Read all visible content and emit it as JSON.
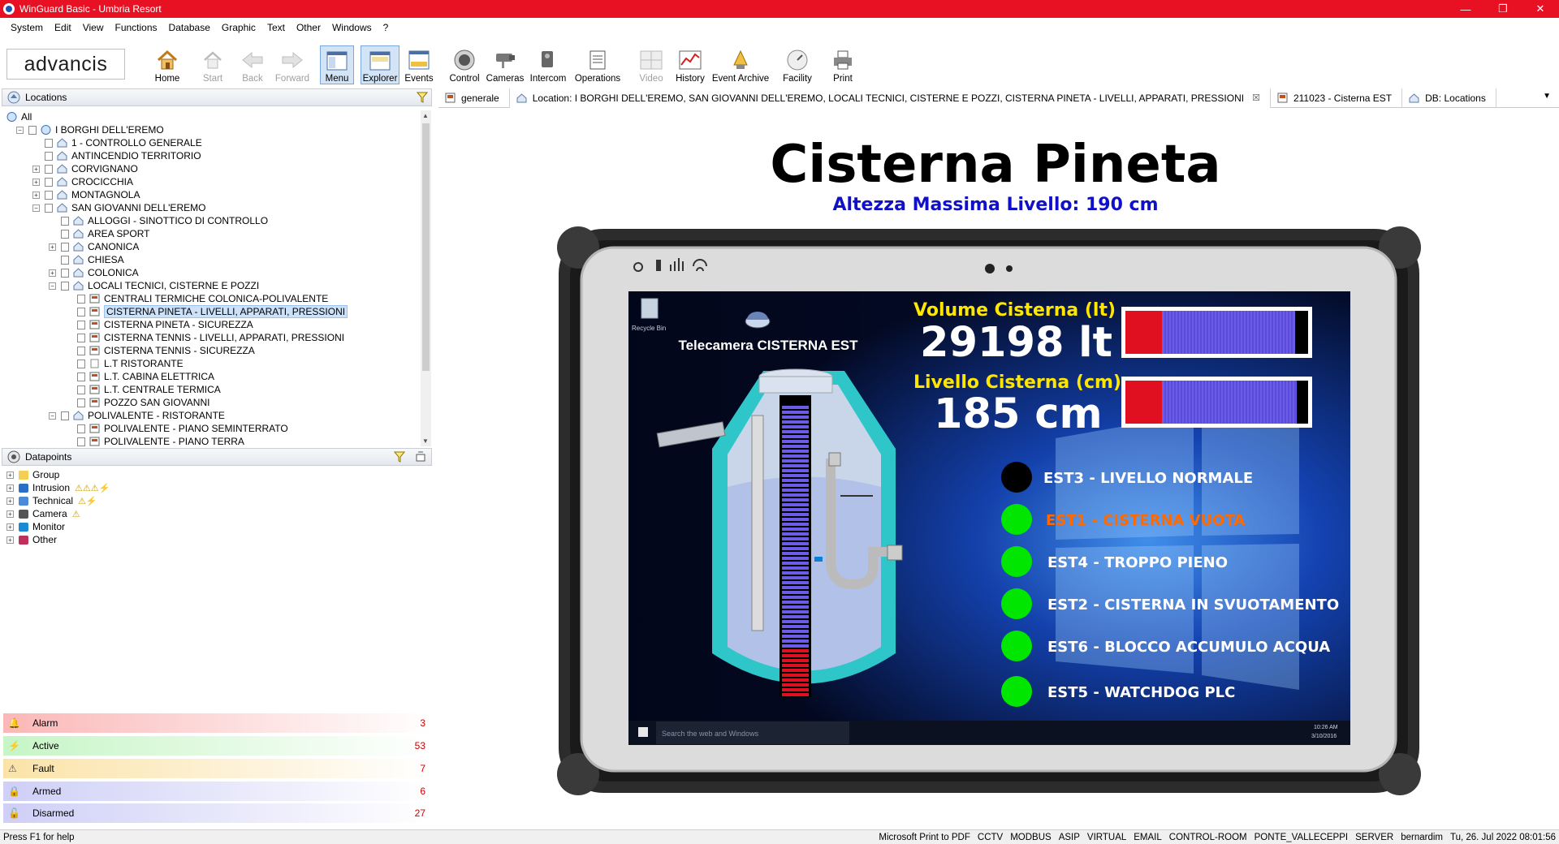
{
  "window": {
    "title": "WinGuard Basic - Umbria Resort"
  },
  "menu": [
    "System",
    "Edit",
    "View",
    "Functions",
    "Database",
    "Graphic",
    "Text",
    "Other",
    "Windows",
    "?"
  ],
  "logo": "advancis",
  "toolbar": {
    "home": "Home",
    "start": "Start",
    "back": "Back",
    "forward": "Forward",
    "menu": "Menu",
    "explorer": "Explorer",
    "events": "Events",
    "control": "Control",
    "cameras": "Cameras",
    "intercom": "Intercom",
    "operations": "Operations",
    "video": "Video",
    "history": "History",
    "event_archive": "Event Archive",
    "facility": "Facility",
    "print": "Print"
  },
  "locations": {
    "title": "Locations",
    "items": [
      "All",
      "I BORGHI DELL'EREMO",
      "1 - CONTROLLO GENERALE",
      "ANTINCENDIO TERRITORIO",
      "CORVIGNANO",
      "CROCICCHIA",
      "MONTAGNOLA",
      "SAN GIOVANNI DELL'EREMO",
      "ALLOGGI - SINOTTICO DI CONTROLLO",
      "AREA SPORT",
      "CANONICA",
      "CHIESA",
      "COLONICA",
      "LOCALI TECNICI, CISTERNE E POZZI",
      "CENTRALI TERMICHE COLONICA-POLIVALENTE",
      "CISTERNA PINETA - LIVELLI, APPARATI, PRESSIONI",
      "CISTERNA PINETA - SICUREZZA",
      "CISTERNA TENNIS - LIVELLI, APPARATI, PRESSIONI",
      "CISTERNA TENNIS - SICUREZZA",
      "L.T RISTORANTE",
      "L.T. CABINA ELETTRICA",
      "L.T. CENTRALE TERMICA",
      "POZZO SAN GIOVANNI",
      "POLIVALENTE - RISTORANTE",
      "POLIVALENTE - PIANO SEMINTERRATO",
      "POLIVALENTE - PIANO TERRA"
    ]
  },
  "datapoints": {
    "title": "Datapoints",
    "items": [
      "Group",
      "Intrusion",
      "Technical",
      "Camera",
      "Monitor",
      "Other"
    ]
  },
  "status": [
    {
      "label": "Alarm",
      "count": "3",
      "color": "#fbb7b7"
    },
    {
      "label": "Active",
      "count": "53",
      "color": "#c6f5c6"
    },
    {
      "label": "Fault",
      "count": "7",
      "color": "#fbe3a8"
    },
    {
      "label": "Armed",
      "count": "6",
      "color": "#cfcff7"
    },
    {
      "label": "Disarmed",
      "count": "27",
      "color": "#cfcff7"
    }
  ],
  "tabs": [
    {
      "label": "generale"
    },
    {
      "label": "Location: I BORGHI DELL'EREMO, SAN GIOVANNI DELL'EREMO, LOCALI TECNICI, CISTERNE E POZZI, CISTERNA PINETA - LIVELLI, APPARATI, PRESSIONI"
    },
    {
      "label": "211023 - Cisterna EST"
    },
    {
      "label": "DB: Locations"
    }
  ],
  "main": {
    "title": "Cisterna Pineta",
    "subtitle": "Altezza Massima Livello: 190 cm",
    "camera_label": "Telecamera CISTERNA EST",
    "recycle_bin": "Recycle Bin",
    "taskbar_search": "Search the web and Windows",
    "taskbar_time": "10:26 AM",
    "taskbar_date": "3/10/2016",
    "volume_label": "Volume Cisterna (lt)",
    "volume_value": "29198 lt",
    "level_label": "Livello Cisterna (cm)",
    "level_value": "185 cm",
    "volume_fill": 0.91,
    "level_fill": 0.92,
    "tank_fill": 0.97,
    "indicators": [
      {
        "label": "EST3 - LIVELLO NORMALE",
        "color": "#000000",
        "text_color": "#ffffff"
      },
      {
        "label": "EST1 - CISTERNA VUOTA",
        "color": "#00e600",
        "text_color": "#ff6a00"
      },
      {
        "label": "EST4 - TROPPO PIENO",
        "color": "#00e600",
        "text_color": "#ffffff"
      },
      {
        "label": "EST2 - CISTERNA IN SVUOTAMENTO",
        "color": "#00e600",
        "text_color": "#ffffff"
      },
      {
        "label": "EST6 - BLOCCO ACCUMULO ACQUA",
        "color": "#00e600",
        "text_color": "#ffffff"
      },
      {
        "label": "EST5 - WATCHDOG PLC",
        "color": "#00e600",
        "text_color": "#ffffff"
      }
    ]
  },
  "statusbar": {
    "help": "Press F1 for help",
    "items": [
      "Microsoft Print to PDF",
      "CCTV",
      "MODBUS",
      "ASIP",
      "VIRTUAL",
      "EMAIL",
      "CONTROL-ROOM",
      "PONTE_VALLECEPPI",
      "SERVER",
      "bernardim",
      "Tu, 26. Jul 2022  08:01:56"
    ]
  }
}
